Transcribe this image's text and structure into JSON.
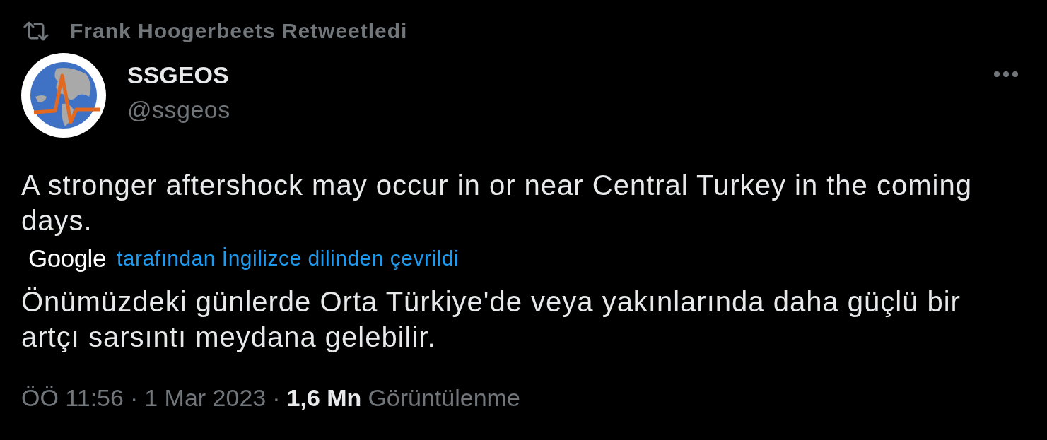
{
  "retweet": {
    "label": "Frank Hoogerbeets Retweetledi"
  },
  "author": {
    "name": "SSGEOS",
    "handle": "@ssgeos"
  },
  "tweet": {
    "text": "A stronger aftershock may occur in or near Central Turkey in the coming days.",
    "translation": {
      "provider": "Google",
      "note": "tarafından İngilizce dilinden çevrildi",
      "text": "Önümüzdeki günlerde Orta Türkiye'de veya yakınlarında daha güçlü bir artçı sarsıntı meydana gelebilir."
    }
  },
  "footer": {
    "time": "ÖÖ 11:56",
    "separator_1": "·",
    "date": "1 Mar 2023",
    "separator_2": "·",
    "views_count": "1,6 Mn",
    "views_label": "Görüntülenme"
  }
}
